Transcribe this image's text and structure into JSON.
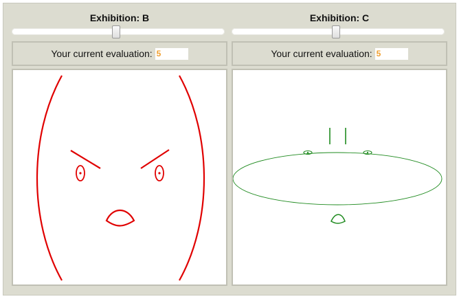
{
  "panels": [
    {
      "title": "Exhibition: B",
      "slider_value": 5,
      "eval_label": "Your current evaluation:",
      "eval_value": "5",
      "face_color": "#e00000"
    },
    {
      "title": "Exhibition: C",
      "slider_value": 5,
      "eval_label": "Your current evaluation:",
      "eval_value": "5",
      "face_color": "#1e8a1e"
    }
  ],
  "slider": {
    "min": 0,
    "max": 10
  },
  "colors": {
    "background": "#dcdcd0",
    "value_text": "#f0a030"
  }
}
